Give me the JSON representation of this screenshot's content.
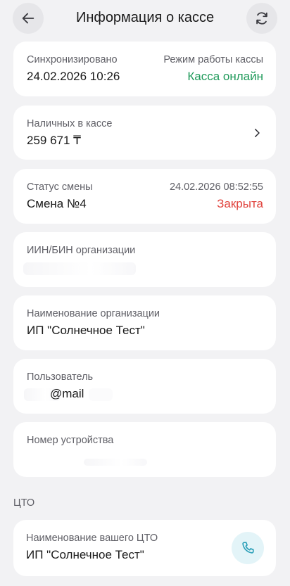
{
  "header": {
    "title": "Информация о кассе",
    "back_icon": "arrow-left-icon",
    "refresh_icon": "refresh-icon"
  },
  "sync": {
    "label": "Синхронизировано",
    "datetime": "24.02.2026 10:26",
    "mode_label": "Режим работы кассы",
    "mode_value": "Касса онлайн"
  },
  "cash": {
    "label": "Наличных в кассе",
    "amount": "259 671 ₸",
    "chevron_icon": "chevron-right-icon"
  },
  "shift": {
    "label": "Статус смены",
    "datetime": "24.02.2026 08:52:55",
    "name": "Смена №4",
    "status": "Закрыта"
  },
  "org_id": {
    "label": "ИИН/БИН организации"
  },
  "org_name": {
    "label": "Наименование организации",
    "value": "ИП \"Солнечное Тест\""
  },
  "user": {
    "label": "Пользователь",
    "value": "@mail"
  },
  "device": {
    "label": "Номер устройства"
  },
  "cto": {
    "section_title": "ЦТО",
    "label": "Наименование вашего ЦТО",
    "value": "ИП \"Солнечное Тест\"",
    "phone_icon": "phone-icon"
  },
  "colors": {
    "accent_green": "#1f9a5a",
    "status_red": "#e0413b",
    "phone_teal": "#2a9fb8",
    "background": "#f2f2f4"
  }
}
